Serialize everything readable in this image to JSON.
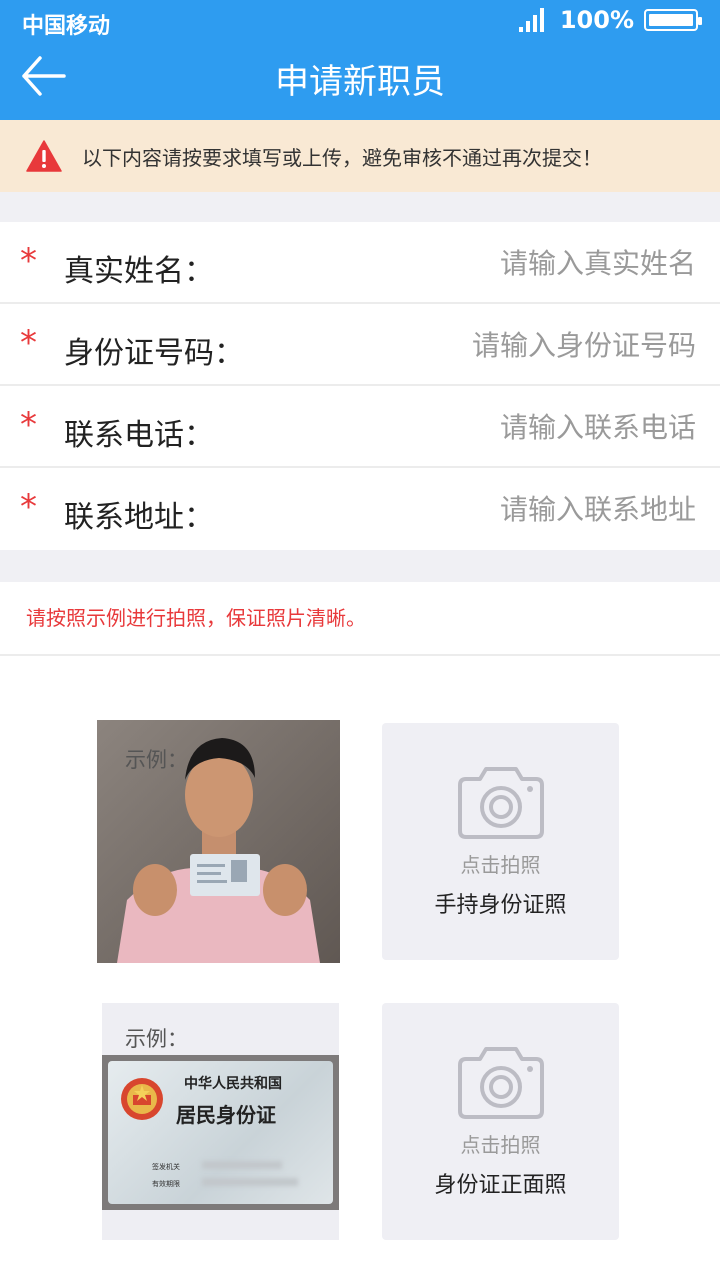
{
  "status_bar": {
    "carrier": "中国移动",
    "battery": "100%"
  },
  "header": {
    "title": "申请新职员",
    "back_icon": "arrow-left-icon",
    "color": "#2e9cf0"
  },
  "notice": {
    "icon": "warning-icon",
    "text": "以下内容请按要求填写或上传，避免审核不通过再次提交！",
    "background": "#f9e9d4"
  },
  "form": {
    "required_mark": "*",
    "fields": [
      {
        "label": "真实姓名：",
        "placeholder": "请输入真实姓名",
        "value": ""
      },
      {
        "label": "身份证号码：",
        "placeholder": "请输入身份证号码",
        "value": ""
      },
      {
        "label": "联系电话：",
        "placeholder": "请输入联系电话",
        "value": ""
      },
      {
        "label": "联系地址：",
        "placeholder": "请输入联系地址",
        "value": ""
      }
    ]
  },
  "photos": {
    "hint": "请按照示例进行拍照，保证照片清晰。",
    "example_label": "示例：",
    "card_text_line1": "中华人民共和国",
    "card_text_line2": "居民身份证",
    "card_field1": "签发机关",
    "card_field2": "有效期限",
    "items": [
      {
        "upload_hint": "点击拍照",
        "upload_label": "手持身份证照",
        "icon": "camera-icon"
      },
      {
        "upload_hint": "点击拍照",
        "upload_label": "身份证正面照",
        "icon": "camera-icon"
      }
    ]
  },
  "colors": {
    "accent_red": "#e8393b",
    "placeholder": "#9a9a9a"
  }
}
